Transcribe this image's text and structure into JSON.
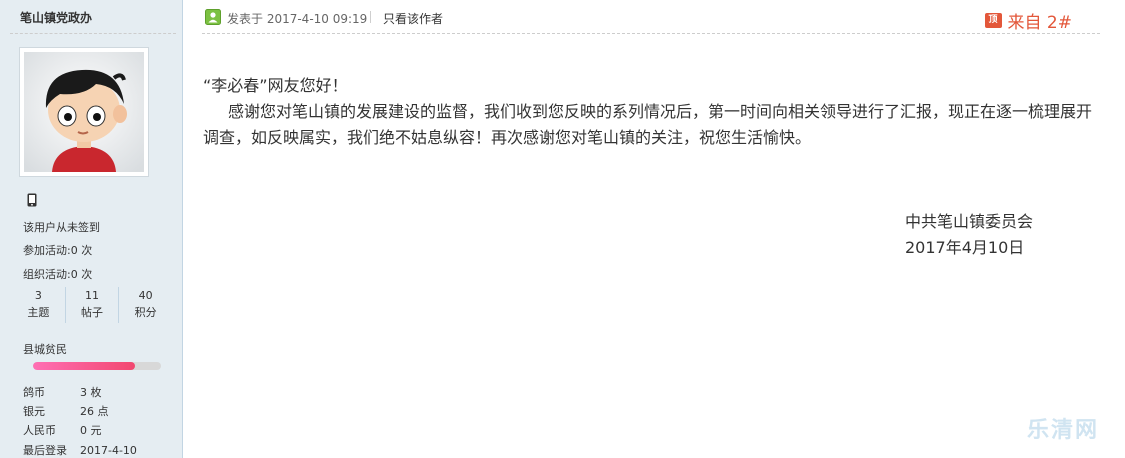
{
  "user": {
    "name": "笔山镇党政办",
    "sign_status": "该用户从未签到",
    "activities_joined": "参加活动:0 次",
    "activities_organized": "组织活动:0 次",
    "stats": [
      {
        "value": "3",
        "label": "主题"
      },
      {
        "value": "11",
        "label": "帖子"
      },
      {
        "value": "40",
        "label": "积分"
      }
    ],
    "rank": "县城贫民",
    "rank_progress": 0.8,
    "details": [
      {
        "key": "鸽币",
        "value": "3 枚"
      },
      {
        "key": "银元",
        "value": "26 点"
      },
      {
        "key": "人民币",
        "value": "0 元"
      },
      {
        "key": "最后登录",
        "value": "2017-4-10"
      }
    ]
  },
  "post": {
    "posted_at": "发表于 2017-4-10 09:19",
    "author_only": "只看该作者",
    "app_badge": "顶",
    "floor": "来自 2#",
    "greeting": "“李必春”网友您好！",
    "paragraph": "感谢您对笔山镇的发展建设的监督，我们收到您反映的系列情况后，第一时间向相关领导进行了汇报，现正在逐一梳理展开调查，如反映属实，我们绝不姑息纵容！再次感谢您对笔山镇的关注，祝您生活愉快。",
    "signature_org": "中共笔山镇委员会",
    "signature_date": "2017年4月10日"
  },
  "watermark": "乐清网",
  "colors": {
    "sidebar_bg": "#e5edf2",
    "accent": "#e3573a",
    "rank_bar": "#f2476f"
  },
  "icons": {
    "post": "online-status-icon",
    "phone": "mobile-phone-icon",
    "app": "app-top-badge-icon"
  }
}
